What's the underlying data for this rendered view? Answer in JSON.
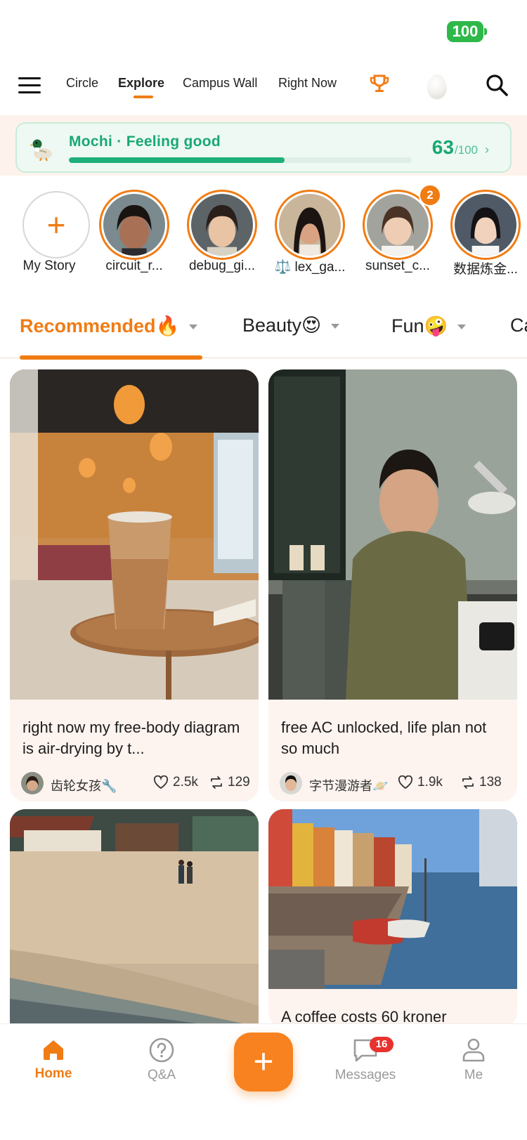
{
  "status": {
    "battery": "100"
  },
  "topnav": {
    "tabs": [
      {
        "label": "Circle"
      },
      {
        "label": "Explore",
        "active": true
      },
      {
        "label": "Campus Wall"
      },
      {
        "label": "Right Now"
      }
    ],
    "icons": [
      "menu-icon",
      "trophy-icon",
      "egg-icon",
      "search-icon"
    ]
  },
  "mood": {
    "title": "Mochi · Feeling good",
    "score": "63",
    "max": "/100",
    "progress": 0.63,
    "chevron": "›"
  },
  "stories": {
    "mine": {
      "label": "My Story",
      "plus": "+"
    },
    "items": [
      {
        "label": "circuit_r..."
      },
      {
        "label": "debug_gi..."
      },
      {
        "label": "⚖️ lex_ga..."
      },
      {
        "label": "sunset_c...",
        "badge": "2"
      },
      {
        "label": "数据炼金..."
      }
    ]
  },
  "categories": [
    {
      "label": "Recommended🔥",
      "active": true
    },
    {
      "label": "Beauty😍"
    },
    {
      "label": "Fun🤪"
    },
    {
      "label": "Ca"
    }
  ],
  "feed": {
    "cards": [
      {
        "title": "right now my free-body diagram is air-drying by t...",
        "author": "齿轮女孩🔧",
        "likes": "2.5k",
        "reposts": "129"
      },
      {
        "title": "free AC unlocked, life plan not so much",
        "author": "字节漫游者🪐",
        "likes": "1.9k",
        "reposts": "138"
      },
      {
        "title": ""
      },
      {
        "title": "A coffee costs 60 kroner"
      }
    ]
  },
  "bottombar": {
    "home": "Home",
    "qa": "Q&A",
    "fab": "+",
    "messages": "Messages",
    "messages_badge": "16",
    "me": "Me"
  },
  "colors": {
    "accent": "#f07c14",
    "mood_green": "#18a873",
    "badge_red": "#e8322e"
  }
}
